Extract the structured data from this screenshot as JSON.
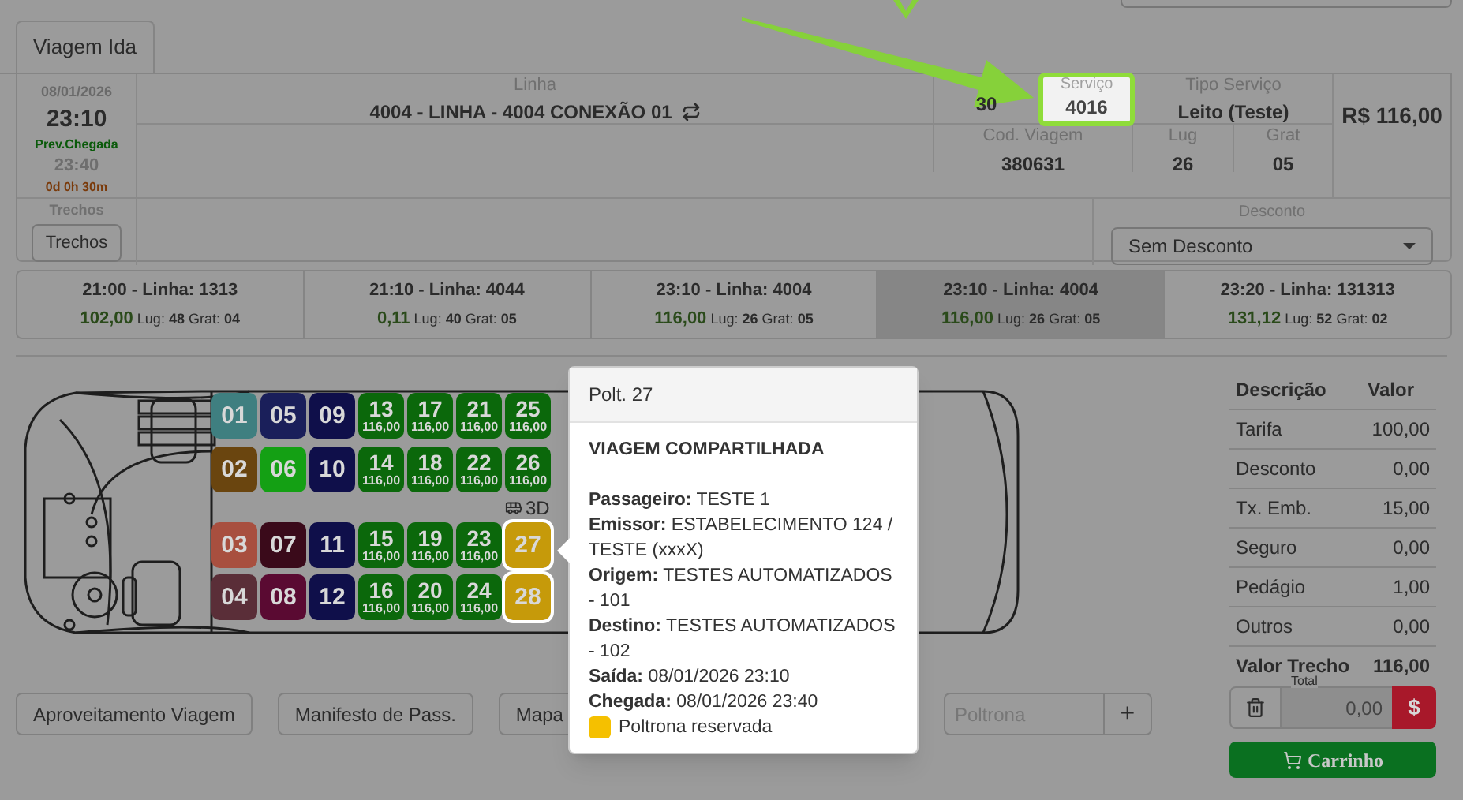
{
  "tabs": [
    {
      "label": "Viagem Ida",
      "selected": true
    }
  ],
  "trip_info": {
    "date": "08/01/2026",
    "departure": "23:10",
    "arrival_label": "Prev.Chegada",
    "arrival": "23:40",
    "duration": "0d 0h 30m",
    "line_label": "Linha",
    "line": "4004 - LINHA - 4004 CONEXÃO 01",
    "column_2": "30",
    "service_label": "Serviço",
    "service": "4016",
    "service_type_label": "Tipo Serviço",
    "service_type": "Leito (Teste)",
    "price": "R$ 116,00",
    "trip_code_label": "Cod. Viagem",
    "trip_code": "380631",
    "seats_label": "Lug",
    "seats": "26",
    "free_label": "Grat",
    "free": "05",
    "segments_label": "Trechos",
    "segments_button": "Trechos",
    "discount_label": "Desconto",
    "discount": "Sem Desconto"
  },
  "trips": [
    {
      "title": "21:00 - Linha: 1313",
      "price": "102,00",
      "lug_label": "Lug:",
      "lug": "48",
      "grat_label": "Grat:",
      "grat": "04",
      "selected": false
    },
    {
      "title": "21:10 - Linha: 4044",
      "price": "0,11",
      "lug_label": "Lug:",
      "lug": "40",
      "grat_label": "Grat:",
      "grat": "05",
      "selected": false
    },
    {
      "title": "23:10 - Linha: 4004",
      "price": "116,00",
      "lug_label": "Lug:",
      "lug": "26",
      "grat_label": "Grat:",
      "grat": "05",
      "selected": false
    },
    {
      "title": "23:10 - Linha: 4004",
      "price": "116,00",
      "lug_label": "Lug:",
      "lug": "26",
      "grat_label": "Grat:",
      "grat": "05",
      "selected": true
    },
    {
      "title": "23:20 - Linha: 131313",
      "price": "131,12",
      "lug_label": "Lug:",
      "lug": "52",
      "grat_label": "Grat:",
      "grat": "02",
      "selected": false
    }
  ],
  "deck_label": "3D",
  "seat_rows": [
    [
      {
        "number": "01",
        "color": "#3f7f80",
        "selected": false
      },
      {
        "number": "05",
        "color": "#1a1f5a",
        "selected": false
      },
      {
        "number": "09",
        "color": "#0f0f4a",
        "selected": false
      },
      {
        "number": "13",
        "price": "116,00",
        "color": "#0b680b",
        "selected": false
      },
      {
        "number": "17",
        "price": "116,00",
        "color": "#0b680b",
        "selected": false
      },
      {
        "number": "21",
        "price": "116,00",
        "color": "#0b680b",
        "selected": false
      },
      {
        "number": "25",
        "price": "116,00",
        "color": "#0b680b",
        "selected": false
      }
    ],
    [
      {
        "number": "02",
        "color": "#6a450f",
        "selected": false
      },
      {
        "number": "06",
        "color": "#14a014",
        "selected": false
      },
      {
        "number": "10",
        "color": "#0f0f4a",
        "selected": false
      },
      {
        "number": "14",
        "price": "116,00",
        "color": "#0b680b",
        "selected": false
      },
      {
        "number": "18",
        "price": "116,00",
        "color": "#0b680b",
        "selected": false
      },
      {
        "number": "22",
        "price": "116,00",
        "color": "#0b680b",
        "selected": false
      },
      {
        "number": "26",
        "price": "116,00",
        "color": "#0b680b",
        "selected": false
      }
    ],
    [
      {
        "number": "03",
        "color": "#a84f3f",
        "selected": false
      },
      {
        "number": "07",
        "color": "#3a0a1a",
        "selected": false
      },
      {
        "number": "11",
        "color": "#0f0f4a",
        "selected": false
      },
      {
        "number": "15",
        "price": "116,00",
        "color": "#0b680b",
        "selected": false
      },
      {
        "number": "19",
        "price": "116,00",
        "color": "#0b680b",
        "selected": false
      },
      {
        "number": "23",
        "price": "116,00",
        "color": "#0b680b",
        "selected": false
      },
      {
        "number": "27",
        "color": "#c69a0a",
        "selected": true
      }
    ],
    [
      {
        "number": "04",
        "color": "#5a2e38",
        "selected": false
      },
      {
        "number": "08",
        "color": "#5a0a32",
        "selected": false
      },
      {
        "number": "12",
        "color": "#0f0f4a",
        "selected": false
      },
      {
        "number": "16",
        "price": "116,00",
        "color": "#0b680b",
        "selected": false
      },
      {
        "number": "20",
        "price": "116,00",
        "color": "#0b680b",
        "selected": false
      },
      {
        "number": "24",
        "price": "116,00",
        "color": "#0b680b",
        "selected": false
      },
      {
        "number": "28",
        "color": "#c69a0a",
        "selected": true
      }
    ]
  ],
  "popover": {
    "header": "Polt. 27",
    "title": "VIAGEM COMPARTILHADA",
    "fields": [
      {
        "label": "Passageiro:",
        "value": "TESTE 1"
      },
      {
        "label": "Emissor:",
        "value": "ESTABELECIMENTO 124 / TESTE (xxxX)"
      },
      {
        "label": "Origem:",
        "value": "TESTES AUTOMATIZADOS - 101"
      },
      {
        "label": "Destino:",
        "value": "TESTES AUTOMATIZADOS - 102"
      },
      {
        "label": "Saída:",
        "value": "08/01/2026 23:10"
      },
      {
        "label": "Chegada:",
        "value": "08/01/2026 23:40"
      }
    ],
    "legend": {
      "text": "Poltrona reservada",
      "color": "#f5c000"
    }
  },
  "actions": [
    "Aproveitamento Viagem",
    "Manifesto de Pass.",
    "Mapa"
  ],
  "seat_input": {
    "placeholder": "Poltrona",
    "button": "+"
  },
  "summary": {
    "columns": [
      "Descrição",
      "Valor"
    ],
    "rows": [
      {
        "label": "Tarifa",
        "value": "100,00"
      },
      {
        "label": "Desconto",
        "value": "0,00"
      },
      {
        "label": "Tx. Emb.",
        "value": "15,00"
      },
      {
        "label": "Seguro",
        "value": "0,00"
      },
      {
        "label": "Pedágio",
        "value": "1,00"
      },
      {
        "label": "Outros",
        "value": "0,00"
      }
    ],
    "total_label": "Valor Trecho",
    "total": "116,00",
    "field_label": "Total",
    "field_value": "0,00",
    "pay_button": "$",
    "cart_button": "Carrinho"
  }
}
